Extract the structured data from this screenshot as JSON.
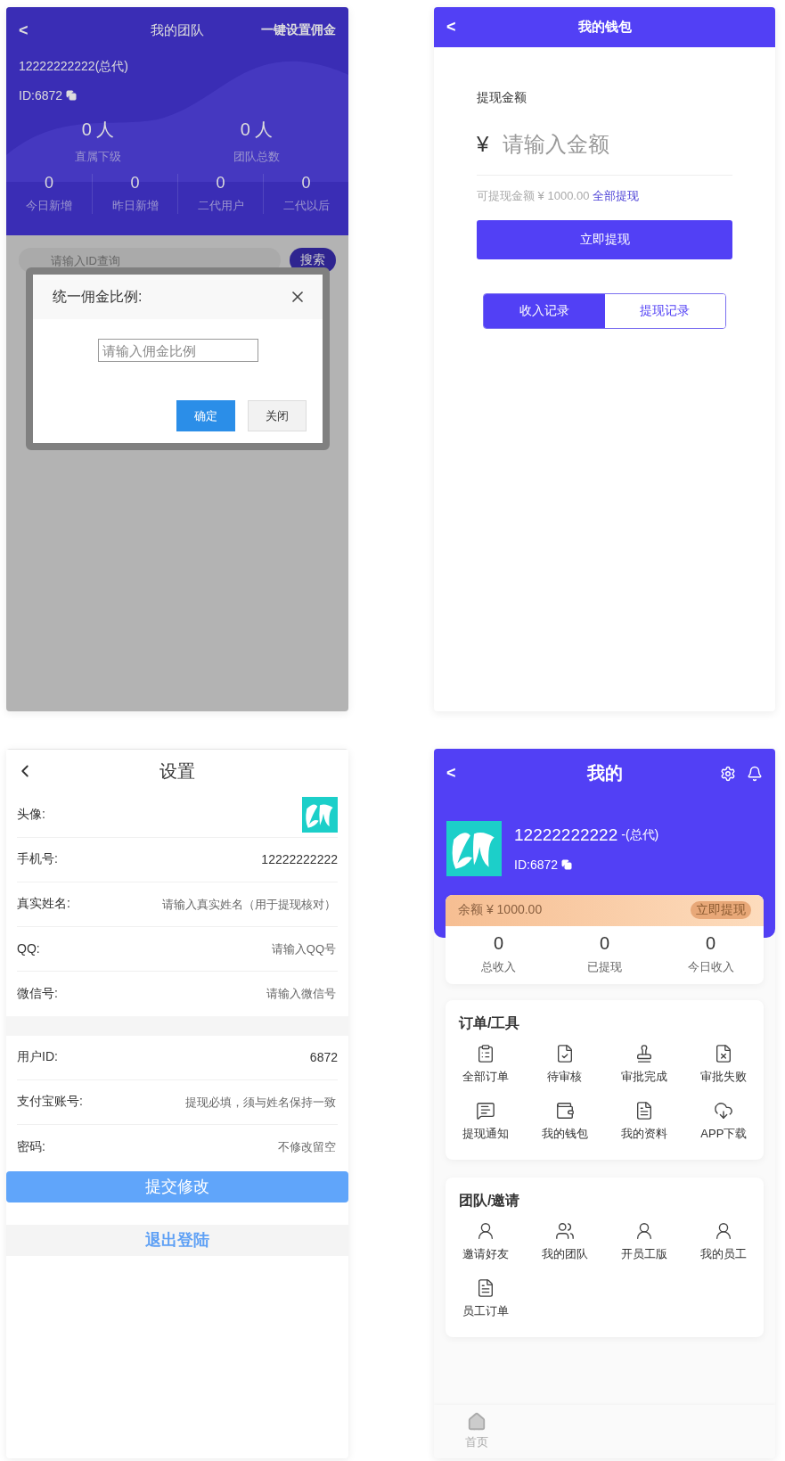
{
  "team_screen": {
    "back": "<",
    "title": "我的团队",
    "action": "一键设置佣金",
    "user_name": "12222222222(总代)",
    "user_id": "ID:6872",
    "summary": [
      {
        "value": "0 人",
        "label": "直属下级"
      },
      {
        "value": "0 人",
        "label": "团队总数"
      }
    ],
    "stats": [
      {
        "value": "0",
        "label": "今日新增"
      },
      {
        "value": "0",
        "label": "昨日新增"
      },
      {
        "value": "0",
        "label": "二代用户"
      },
      {
        "value": "0",
        "label": "二代以后"
      }
    ],
    "search": {
      "placeholder": "请输入ID查询",
      "button": "搜索"
    },
    "dialog": {
      "title": "统一佣金比例:",
      "placeholder": "请输入佣金比例",
      "buttons": [
        {
          "label": "确定",
          "kind": "primary"
        },
        {
          "label": "关闭",
          "kind": "default"
        }
      ]
    }
  },
  "wallet_screen": {
    "back": "<",
    "title": "我的钱包",
    "amount_label": "提现金额",
    "currency": "¥",
    "amount_placeholder": "请输入金额",
    "available": "可提现金额 ¥ 1000.00",
    "withdraw_all": "全部提现",
    "submit": "立即提现",
    "tabs": [
      {
        "label": "收入记录",
        "selected": true
      },
      {
        "label": "提现记录",
        "selected": false
      }
    ]
  },
  "settings_screen": {
    "title": "设置",
    "groups": [
      {
        "rows": [
          {
            "kind": "avatar",
            "label": "头像:"
          },
          {
            "kind": "text",
            "label": "手机号:",
            "value": "12222222222"
          },
          {
            "kind": "input",
            "label": "真实姓名:",
            "placeholder": "请输入真实姓名（用于提现核对）"
          },
          {
            "kind": "input",
            "label": "QQ:",
            "placeholder": "请输入QQ号"
          },
          {
            "kind": "input",
            "label": "微信号:",
            "placeholder": "请输入微信号"
          }
        ]
      },
      {
        "rows": [
          {
            "kind": "text",
            "label": "用户ID:",
            "value": "6872"
          },
          {
            "kind": "input",
            "label": "支付宝账号:",
            "placeholder": "提现必填，须与姓名保持一致"
          },
          {
            "kind": "input",
            "label": "密码:",
            "placeholder": "不修改留空"
          }
        ]
      }
    ],
    "submit": "提交修改",
    "logout": "退出登陆"
  },
  "profile_screen": {
    "back": "<",
    "title": "我的",
    "user_name": "12222222222",
    "role": "-(总代)",
    "user_id": "ID:6872",
    "balance_label": "余额",
    "balance": "¥ 1000.00",
    "withdraw": "立即提现",
    "stats": [
      {
        "value": "0",
        "label": "总收入"
      },
      {
        "value": "0",
        "label": "已提现"
      },
      {
        "value": "0",
        "label": "今日收入"
      }
    ],
    "sections": [
      {
        "title": "订单/工具",
        "items": [
          {
            "label": "全部订单"
          },
          {
            "label": "待审核"
          },
          {
            "label": "审批完成"
          },
          {
            "label": "审批失败"
          },
          {
            "label": "提现通知"
          },
          {
            "label": "我的钱包"
          },
          {
            "label": "我的资料"
          },
          {
            "label": "APP下载"
          }
        ]
      },
      {
        "title": "团队/邀请",
        "items": [
          {
            "label": "邀请好友"
          },
          {
            "label": "我的团队"
          },
          {
            "label": "开员工版"
          },
          {
            "label": "我的员工"
          },
          {
            "label": "员工订单"
          }
        ]
      }
    ],
    "nav": [
      {
        "label": "首页"
      }
    ]
  }
}
